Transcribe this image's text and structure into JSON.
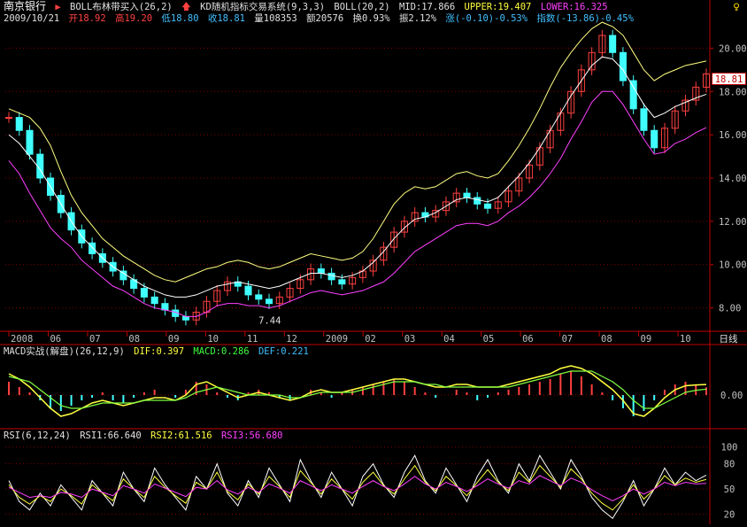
{
  "header": {
    "stock_name": "南京银行",
    "indicator_1": "BOLL布林带买入(26,2)",
    "indicator_2": "KD随机指标交易系统(9,3,3)",
    "boll_label": "BOLL(20,2)",
    "mid": "MID:17.866",
    "upper": "UPPER:19.407",
    "lower": "LOWER:16.325",
    "date": "2009/10/21",
    "open": "开18.92",
    "high": "高19.20",
    "low": "低18.80",
    "close": "收18.81",
    "volume": "量108353",
    "amount": "额20576",
    "turnover": "换0.93%",
    "amplitude": "振2.12%",
    "change": "涨(-0.10)-0.53%",
    "index": "指数(-13.86)-0.45%"
  },
  "current_price": "18.81",
  "period_label": "日线",
  "macd_header": {
    "name": "MACD实战(解盘)(26,12,9)",
    "dif": "DIF:0.397",
    "macd": "MACD:0.286",
    "def": "DEF:0.221"
  },
  "rsi_header": {
    "name": "RSI(6,12,24)",
    "rsi1": "RSI1:66.640",
    "rsi2": "RSI2:61.516",
    "rsi3": "RSI3:56.680"
  },
  "colors": {
    "up": "#ff4040",
    "down": "#40ffff",
    "upper_band": "#ffff80",
    "mid_band": "#ffffff",
    "lower_band": "#ff40ff",
    "grid": "#800000",
    "axis": "#c00000"
  },
  "chart_data": [
    {
      "type": "line",
      "name": "price",
      "ylim": [
        7,
        21
      ],
      "yticks": [
        "20.00",
        "18.00",
        "16.00",
        "14.00",
        "12.00",
        "10.00",
        "8.00"
      ],
      "ytick_values": [
        20,
        18,
        16,
        14,
        12,
        10,
        8
      ],
      "x_labels": [
        "2008",
        "06",
        "07",
        "08",
        "09",
        "10",
        "11",
        "12",
        "2009",
        "02",
        "03",
        "04",
        "05",
        "06",
        "07",
        "08",
        "09",
        "10"
      ],
      "annotations": [
        {
          "label": "20.59",
          "x_index": 18,
          "value": 20.59
        },
        {
          "label": "7.44",
          "x_index": 6,
          "value": 7.44
        }
      ],
      "close": [
        16.8,
        16.2,
        15.1,
        14.0,
        13.2,
        12.4,
        11.6,
        11.0,
        10.5,
        10.1,
        9.7,
        9.3,
        8.9,
        8.5,
        8.2,
        7.9,
        7.6,
        7.44,
        7.8,
        8.3,
        8.8,
        9.2,
        9.0,
        8.6,
        8.4,
        8.2,
        8.5,
        8.9,
        9.3,
        9.8,
        9.6,
        9.3,
        9.1,
        9.4,
        9.7,
        10.2,
        10.8,
        11.5,
        12.0,
        12.4,
        12.2,
        12.5,
        12.9,
        13.3,
        13.1,
        12.8,
        12.6,
        12.9,
        13.4,
        14.0,
        14.6,
        15.4,
        16.2,
        17.0,
        18.0,
        19.0,
        19.8,
        20.59,
        19.8,
        18.5,
        17.2,
        16.2,
        15.4,
        16.3,
        17.1,
        17.6,
        18.2,
        18.81
      ],
      "upper": [
        17.2,
        17.0,
        16.8,
        16.3,
        15.5,
        14.3,
        13.2,
        12.4,
        11.8,
        11.2,
        10.8,
        10.4,
        10.1,
        9.8,
        9.5,
        9.3,
        9.2,
        9.4,
        9.6,
        9.8,
        9.9,
        10.1,
        10.2,
        10.1,
        9.9,
        9.8,
        9.9,
        10.1,
        10.3,
        10.5,
        10.4,
        10.3,
        10.2,
        10.3,
        10.6,
        11.2,
        12.0,
        12.8,
        13.3,
        13.6,
        13.5,
        13.6,
        13.9,
        14.2,
        14.3,
        14.1,
        14.0,
        14.2,
        14.8,
        15.5,
        16.3,
        17.2,
        18.2,
        19.1,
        19.8,
        20.4,
        20.9,
        21.2,
        21.0,
        20.6,
        19.8,
        19.0,
        18.5,
        18.8,
        19.0,
        19.2,
        19.3,
        19.41
      ],
      "mid": [
        16.0,
        15.6,
        15.0,
        14.4,
        13.6,
        12.8,
        12.0,
        11.3,
        10.8,
        10.3,
        9.9,
        9.6,
        9.3,
        9.0,
        8.8,
        8.6,
        8.5,
        8.5,
        8.6,
        8.8,
        9.0,
        9.1,
        9.2,
        9.1,
        9.0,
        8.9,
        9.0,
        9.2,
        9.4,
        9.6,
        9.6,
        9.5,
        9.4,
        9.5,
        9.7,
        10.1,
        10.6,
        11.2,
        11.7,
        12.1,
        12.2,
        12.4,
        12.7,
        13.0,
        13.1,
        13.0,
        12.9,
        13.1,
        13.6,
        14.1,
        14.7,
        15.4,
        16.2,
        17.0,
        17.8,
        18.5,
        19.2,
        19.6,
        19.5,
        19.0,
        18.2,
        17.4,
        16.8,
        17.0,
        17.3,
        17.5,
        17.7,
        17.87
      ],
      "lower": [
        14.8,
        14.2,
        13.3,
        12.5,
        11.7,
        11.2,
        10.8,
        10.2,
        9.8,
        9.4,
        9.0,
        8.8,
        8.5,
        8.2,
        8.0,
        7.9,
        7.8,
        7.6,
        7.6,
        7.8,
        8.1,
        8.2,
        8.2,
        8.1,
        8.1,
        8.0,
        8.1,
        8.3,
        8.5,
        8.7,
        8.8,
        8.7,
        8.6,
        8.7,
        8.8,
        9.0,
        9.2,
        9.6,
        10.1,
        10.6,
        10.9,
        11.2,
        11.5,
        11.8,
        11.9,
        11.9,
        11.8,
        12.0,
        12.4,
        12.7,
        13.1,
        13.6,
        14.2,
        14.9,
        15.8,
        16.6,
        17.5,
        18.0,
        18.0,
        17.4,
        16.6,
        15.8,
        15.1,
        15.2,
        15.6,
        15.8,
        16.1,
        16.33
      ]
    },
    {
      "type": "bar",
      "name": "macd",
      "ylim": [
        -1.2,
        1.4
      ],
      "yticks": [
        "0.00"
      ],
      "ytick_values": [
        0
      ],
      "values": [
        0.5,
        0.3,
        0.1,
        -0.2,
        -0.5,
        -0.6,
        -0.4,
        -0.2,
        -0.1,
        0.1,
        -0.2,
        -0.3,
        -0.1,
        0.1,
        0.2,
        0.0,
        -0.1,
        0.2,
        0.5,
        0.4,
        0.1,
        -0.1,
        -0.2,
        0.1,
        0.2,
        0.1,
        -0.1,
        -0.2,
        0.0,
        0.2,
        0.1,
        -0.1,
        0.1,
        0.2,
        0.3,
        0.4,
        0.5,
        0.6,
        0.5,
        0.3,
        0.1,
        -0.1,
        0.0,
        0.2,
        0.1,
        -0.2,
        -0.1,
        0.1,
        0.2,
        0.3,
        0.4,
        0.5,
        0.6,
        0.8,
        0.9,
        0.7,
        0.4,
        0.1,
        -0.2,
        -0.5,
        -0.8,
        -0.6,
        -0.2,
        0.2,
        0.4,
        0.5,
        0.4,
        0.29
      ],
      "dif": [
        0.8,
        0.6,
        0.3,
        -0.1,
        -0.5,
        -0.8,
        -0.7,
        -0.5,
        -0.3,
        -0.2,
        -0.3,
        -0.4,
        -0.3,
        -0.2,
        -0.1,
        -0.1,
        -0.2,
        0.0,
        0.4,
        0.5,
        0.3,
        0.1,
        -0.1,
        0.0,
        0.1,
        0.0,
        -0.1,
        -0.2,
        -0.1,
        0.1,
        0.2,
        0.1,
        0.1,
        0.2,
        0.3,
        0.4,
        0.5,
        0.6,
        0.6,
        0.5,
        0.4,
        0.3,
        0.3,
        0.4,
        0.4,
        0.3,
        0.3,
        0.3,
        0.4,
        0.5,
        0.6,
        0.7,
        0.8,
        1.0,
        1.1,
        1.0,
        0.8,
        0.5,
        0.2,
        -0.2,
        -0.7,
        -0.8,
        -0.5,
        -0.1,
        0.2,
        0.35,
        0.38,
        0.397
      ],
      "dea": [
        0.7,
        0.6,
        0.5,
        0.2,
        -0.1,
        -0.4,
        -0.5,
        -0.5,
        -0.4,
        -0.3,
        -0.3,
        -0.3,
        -0.3,
        -0.2,
        -0.2,
        -0.2,
        -0.2,
        -0.1,
        0.1,
        0.2,
        0.3,
        0.2,
        0.1,
        0.0,
        0.0,
        0.0,
        0.0,
        -0.1,
        -0.1,
        0.0,
        0.1,
        0.1,
        0.1,
        0.1,
        0.2,
        0.3,
        0.4,
        0.5,
        0.5,
        0.5,
        0.4,
        0.4,
        0.3,
        0.3,
        0.3,
        0.3,
        0.3,
        0.3,
        0.3,
        0.4,
        0.5,
        0.6,
        0.7,
        0.8,
        0.9,
        0.9,
        0.9,
        0.7,
        0.5,
        0.2,
        -0.2,
        -0.5,
        -0.5,
        -0.3,
        -0.1,
        0.1,
        0.18,
        0.221
      ]
    },
    {
      "type": "line",
      "name": "rsi",
      "ylim": [
        10,
        105
      ],
      "yticks": [
        "100",
        "80",
        "50",
        "20"
      ],
      "ytick_values": [
        100,
        80,
        50,
        20
      ],
      "rsi1": [
        60,
        35,
        25,
        45,
        30,
        55,
        40,
        25,
        60,
        45,
        30,
        70,
        50,
        35,
        75,
        55,
        40,
        25,
        65,
        50,
        80,
        45,
        30,
        60,
        40,
        75,
        55,
        35,
        85,
        60,
        40,
        70,
        50,
        30,
        65,
        80,
        55,
        40,
        70,
        90,
        60,
        45,
        75,
        55,
        35,
        65,
        85,
        60,
        45,
        80,
        60,
        90,
        70,
        50,
        85,
        65,
        40,
        25,
        15,
        35,
        60,
        30,
        50,
        75,
        55,
        70,
        60,
        66.6
      ],
      "rsi2": [
        55,
        40,
        32,
        42,
        35,
        50,
        42,
        32,
        55,
        45,
        36,
        62,
        50,
        40,
        65,
        52,
        42,
        33,
        58,
        50,
        70,
        47,
        37,
        56,
        44,
        65,
        53,
        40,
        72,
        58,
        44,
        62,
        50,
        38,
        58,
        70,
        54,
        44,
        62,
        78,
        58,
        48,
        65,
        54,
        42,
        58,
        73,
        58,
        48,
        70,
        58,
        78,
        65,
        52,
        74,
        62,
        45,
        33,
        25,
        38,
        55,
        38,
        50,
        66,
        55,
        63,
        58,
        61.5
      ],
      "rsi3": [
        52,
        46,
        40,
        42,
        40,
        46,
        44,
        40,
        50,
        46,
        42,
        54,
        50,
        45,
        56,
        51,
        46,
        41,
        52,
        50,
        60,
        49,
        44,
        52,
        46,
        56,
        51,
        45,
        60,
        54,
        48,
        55,
        50,
        45,
        53,
        60,
        53,
        48,
        56,
        65,
        56,
        50,
        58,
        53,
        47,
        54,
        62,
        56,
        51,
        60,
        56,
        66,
        60,
        54,
        63,
        58,
        49,
        42,
        36,
        42,
        50,
        44,
        50,
        58,
        54,
        58,
        56,
        56.7
      ]
    }
  ]
}
